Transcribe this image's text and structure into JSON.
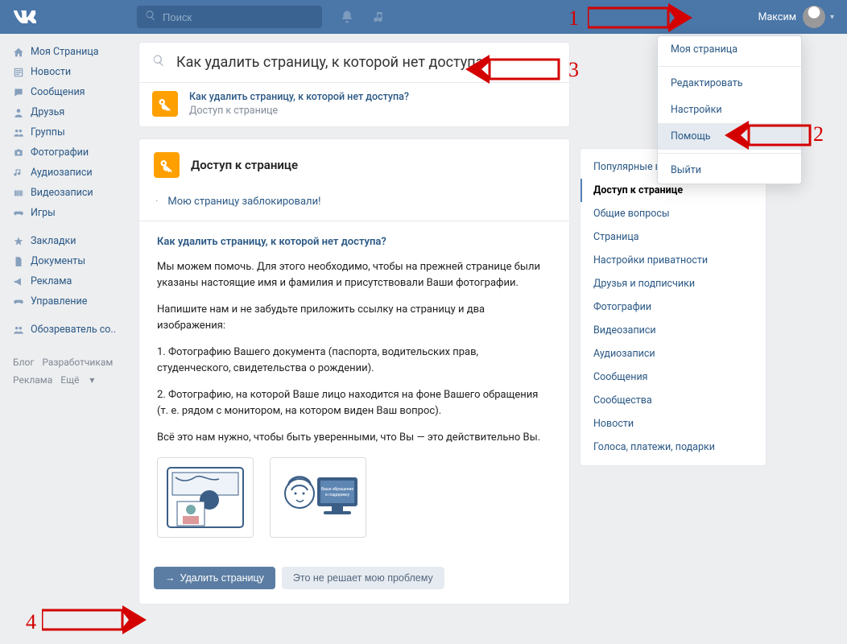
{
  "header": {
    "search_placeholder": "Поиск",
    "username": "Максим"
  },
  "sidebar": {
    "items": [
      {
        "icon": "home",
        "label": "Моя Страница"
      },
      {
        "icon": "news",
        "label": "Новости"
      },
      {
        "icon": "msg",
        "label": "Сообщения"
      },
      {
        "icon": "friends",
        "label": "Друзья"
      },
      {
        "icon": "groups",
        "label": "Группы"
      },
      {
        "icon": "photo",
        "label": "Фотографии"
      },
      {
        "icon": "audio",
        "label": "Аудиозаписи"
      },
      {
        "icon": "video",
        "label": "Видеозаписи"
      },
      {
        "icon": "games",
        "label": "Игры"
      }
    ],
    "items2": [
      {
        "icon": "star",
        "label": "Закладки"
      },
      {
        "icon": "doc",
        "label": "Документы"
      },
      {
        "icon": "ads",
        "label": "Реклама"
      },
      {
        "icon": "manage",
        "label": "Управление"
      }
    ],
    "items3": [
      {
        "icon": "people",
        "label": "Обозреватель со.."
      }
    ],
    "footer": {
      "l1a": "Блог",
      "l1b": "Разработчикам",
      "l2a": "Реклама",
      "l2b": "Ещё"
    }
  },
  "help_search": {
    "query": "Как удалить страницу, к которой нет доступа",
    "suggest_title": "Как удалить страницу, к которой нет доступа?",
    "suggest_sub": "Доступ к странице"
  },
  "article": {
    "section_title": "Доступ к странице",
    "link1": "Мою страницу заблокировали!",
    "q": "Как удалить страницу, к которой нет доступа?",
    "p1": "Мы можем помочь. Для этого необходимо, чтобы на прежней странице были указаны настоящие имя и фамилия и присутствовали Ваши фотографии.",
    "p2": "Напишите нам и не забудьте приложить ссылку на страницу и два изображения:",
    "p3": "1. Фотографию Вашего документа (паспорта, водительских прав, студенческого, свидетельства о рождении).",
    "p4": "2. Фотографию, на которой Ваше лицо находится на фоне Вашего обращения (т. е. рядом с монитором, на котором виден Ваш вопрос).",
    "p5": "Всё это нам нужно, чтобы быть уверенными, что Вы — это действительно Вы.",
    "btn_primary": "Удалить страницу",
    "btn_secondary": "Это не решает мою проблему"
  },
  "rightcol": {
    "items": [
      {
        "label": "Популярные вопросы",
        "active": false
      },
      {
        "label": "Доступ к странице",
        "active": true
      },
      {
        "label": "Общие вопросы",
        "active": false
      },
      {
        "label": "Страница",
        "active": false
      },
      {
        "label": "Настройки приватности",
        "active": false
      },
      {
        "label": "Друзья и подписчики",
        "active": false
      },
      {
        "label": "Фотографии",
        "active": false
      },
      {
        "label": "Видеозаписи",
        "active": false
      },
      {
        "label": "Аудиозаписи",
        "active": false
      },
      {
        "label": "Сообщения",
        "active": false
      },
      {
        "label": "Сообщества",
        "active": false
      },
      {
        "label": "Новости",
        "active": false
      },
      {
        "label": "Голоса, платежи, подарки",
        "active": false
      }
    ]
  },
  "dropdown": {
    "items": [
      {
        "label": "Моя страница",
        "h": false
      },
      {
        "label": "Редактировать",
        "h": false
      },
      {
        "label": "Настройки",
        "h": false
      },
      {
        "label": "Помощь",
        "h": true
      },
      {
        "label": "Выйти",
        "h": false
      }
    ]
  },
  "annotations": {
    "n1": "1",
    "n2": "2",
    "n3": "3",
    "n4": "4"
  }
}
